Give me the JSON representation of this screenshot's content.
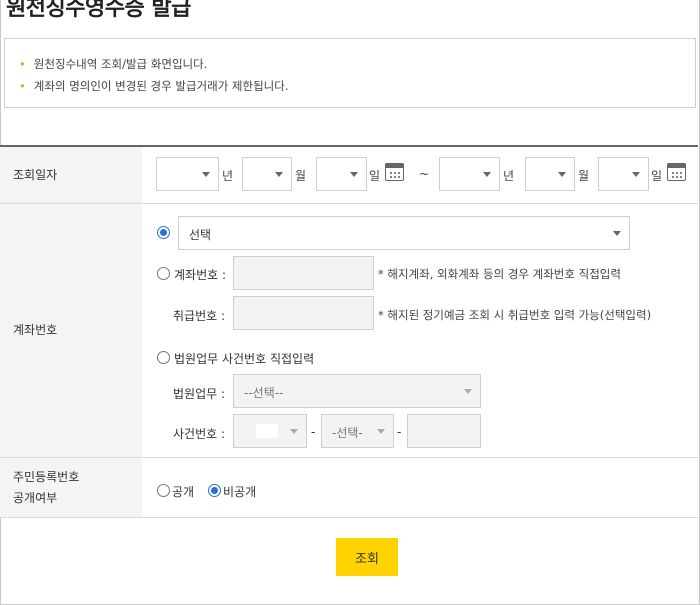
{
  "title": "원천징수영수증 발급",
  "notices": [
    "원천징수내역 조회/발급 화면입니다.",
    "계좌의 명의인이 변경된 경우 발급거래가 제한됩니다."
  ],
  "date_row": {
    "label": "조회일자",
    "year_unit": "년",
    "month_unit": "월",
    "day_unit": "일",
    "separator": "~"
  },
  "account_row": {
    "label": "계좌번호",
    "account_select": "선택",
    "direct_label": "계좌번호 :",
    "direct_note": "* 해지계좌, 외화계좌 등의 경우 계좌번호 직접입력",
    "handling_label": "취급번호 :",
    "handling_note": "* 해지된 정기예금 조회 시 취급번호 입력 가능(선택입력)",
    "court_option": "법원업무 사건번호 직접입력",
    "court_label": "법원업무 :",
    "court_select": "--선택--",
    "case_label": "사건번호 :",
    "case_type_select": "-선택-",
    "dash": "-"
  },
  "resident_row": {
    "label_line1": "주민등록번호",
    "label_line2": "공개여부",
    "public": "공개",
    "private": "비공개"
  },
  "submit_label": "조회",
  "colors": {
    "button": "#ffd200",
    "radio_selected": "#2a6fd6",
    "notice_dot": "#e8a32b"
  }
}
